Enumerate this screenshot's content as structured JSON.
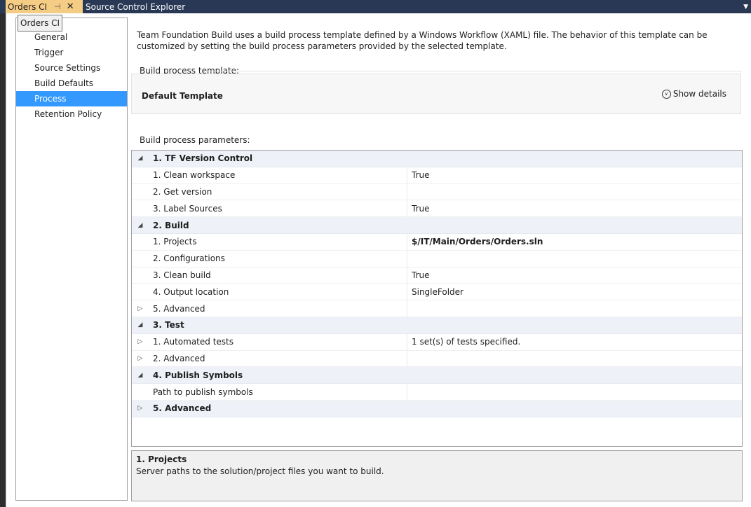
{
  "tabs": {
    "active": "Orders CI",
    "inactive": "Source Control Explorer"
  },
  "tooltip": "Orders CI",
  "sidebar": {
    "items": [
      {
        "label": "General"
      },
      {
        "label": "Trigger"
      },
      {
        "label": "Source Settings"
      },
      {
        "label": "Build Defaults"
      },
      {
        "label": "Process",
        "selected": true
      },
      {
        "label": "Retention Policy"
      }
    ]
  },
  "main": {
    "description": "Team Foundation Build uses a build process template defined by a Windows Workflow (XAML) file. The behavior of this template can be customized by setting the build process parameters provided by the selected template.",
    "template_label": "Build process template:",
    "template_name": "Default Template",
    "show_details": "Show details",
    "params_label": "Build process parameters:"
  },
  "grid": {
    "rows": [
      {
        "type": "cat",
        "expander": "expanded",
        "name": "1. TF Version Control",
        "value": ""
      },
      {
        "type": "item",
        "expander": "",
        "name": "1. Clean workspace",
        "value": "True"
      },
      {
        "type": "item",
        "expander": "",
        "name": "2. Get version",
        "value": ""
      },
      {
        "type": "item",
        "expander": "",
        "name": "3. Label Sources",
        "value": "True"
      },
      {
        "type": "cat",
        "expander": "expanded",
        "name": "2. Build",
        "value": ""
      },
      {
        "type": "item",
        "expander": "",
        "name": "1. Projects",
        "value": "$/IT/Main/Orders/Orders.sln",
        "bold": true
      },
      {
        "type": "item",
        "expander": "",
        "name": "2. Configurations",
        "value": ""
      },
      {
        "type": "item",
        "expander": "",
        "name": "3. Clean build",
        "value": "True"
      },
      {
        "type": "item",
        "expander": "",
        "name": "4. Output location",
        "value": "SingleFolder"
      },
      {
        "type": "item",
        "expander": "collapsed",
        "name": "5. Advanced",
        "value": ""
      },
      {
        "type": "cat",
        "expander": "expanded",
        "name": "3. Test",
        "value": ""
      },
      {
        "type": "item",
        "expander": "collapsed",
        "name": "1. Automated tests",
        "value": "1 set(s) of tests specified."
      },
      {
        "type": "item",
        "expander": "collapsed",
        "name": "2. Advanced",
        "value": ""
      },
      {
        "type": "cat",
        "expander": "expanded",
        "name": "4. Publish Symbols",
        "value": ""
      },
      {
        "type": "item",
        "expander": "",
        "name": "Path to publish symbols",
        "value": ""
      },
      {
        "type": "cat",
        "expander": "collapsed",
        "name": "5. Advanced",
        "value": ""
      }
    ]
  },
  "help": {
    "title": "1. Projects",
    "text": "Server paths to the solution/project files you want to build."
  },
  "icons": {
    "expanded": "◢",
    "collapsed": "▷",
    "pin": "⊣",
    "close": "✕",
    "overflow": "▼",
    "chevron": "∨"
  }
}
